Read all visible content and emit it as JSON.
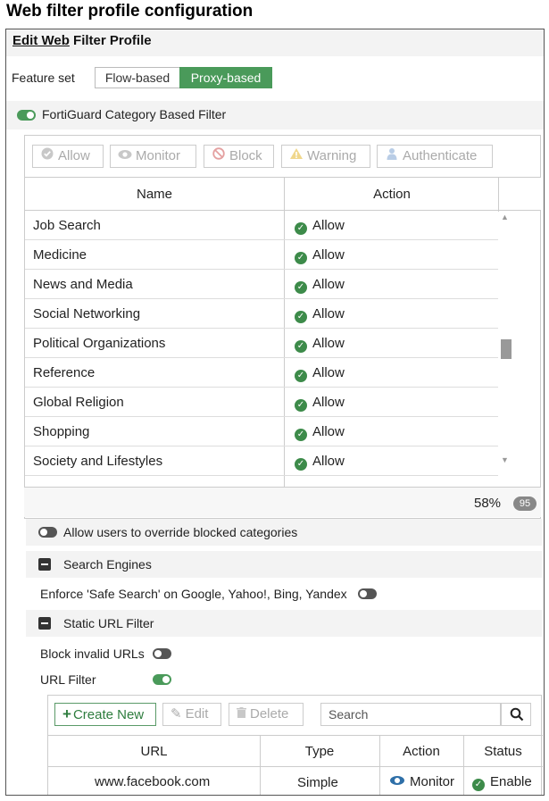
{
  "page_heading": "Web filter profile configuration",
  "title": {
    "part1": "Edit Web",
    "part2": " Filter Profile"
  },
  "feature_set": {
    "label": "Feature set",
    "options": [
      "Flow-based",
      "Proxy-based"
    ],
    "selected": "Proxy-based"
  },
  "fortiguard": {
    "label": "FortiGuard Category Based Filter",
    "enabled": true
  },
  "category_toolbar": [
    "Allow",
    "Monitor",
    "Block",
    "Warning",
    "Authenticate"
  ],
  "category_table": {
    "columns": [
      "Name",
      "Action"
    ],
    "rows": [
      {
        "name": "Job Search",
        "action": "Allow"
      },
      {
        "name": "Medicine",
        "action": "Allow"
      },
      {
        "name": "News and Media",
        "action": "Allow"
      },
      {
        "name": "Social Networking",
        "action": "Allow"
      },
      {
        "name": "Political Organizations",
        "action": "Allow"
      },
      {
        "name": "Reference",
        "action": "Allow"
      },
      {
        "name": "Global Religion",
        "action": "Allow"
      },
      {
        "name": "Shopping",
        "action": "Allow"
      },
      {
        "name": "Society and Lifestyles",
        "action": "Allow"
      }
    ],
    "percent": "58%",
    "count": "95"
  },
  "override": {
    "label": "Allow users to override blocked categories",
    "enabled": false
  },
  "search_engines": {
    "label": "Search Engines",
    "safe_search_label": "Enforce 'Safe Search' on Google, Yahoo!, Bing, Yandex",
    "safe_search_enabled": false
  },
  "static_url": {
    "label": "Static URL Filter",
    "block_invalid_label": "Block invalid URLs",
    "block_invalid_enabled": false,
    "url_filter_label": "URL Filter",
    "url_filter_enabled": true
  },
  "url_toolbar": {
    "create": "Create New",
    "edit": "Edit",
    "delete": "Delete",
    "search_placeholder": "Search"
  },
  "url_table": {
    "columns": [
      "URL",
      "Type",
      "Action",
      "Status"
    ],
    "rows": [
      {
        "url": "www.facebook.com",
        "type": "Simple",
        "action": "Monitor",
        "status": "Enable"
      }
    ]
  },
  "colors": {
    "accent_green": "#4a9a5a",
    "allow_green": "#3d8b4a",
    "monitor_blue": "#2e6fa8"
  }
}
